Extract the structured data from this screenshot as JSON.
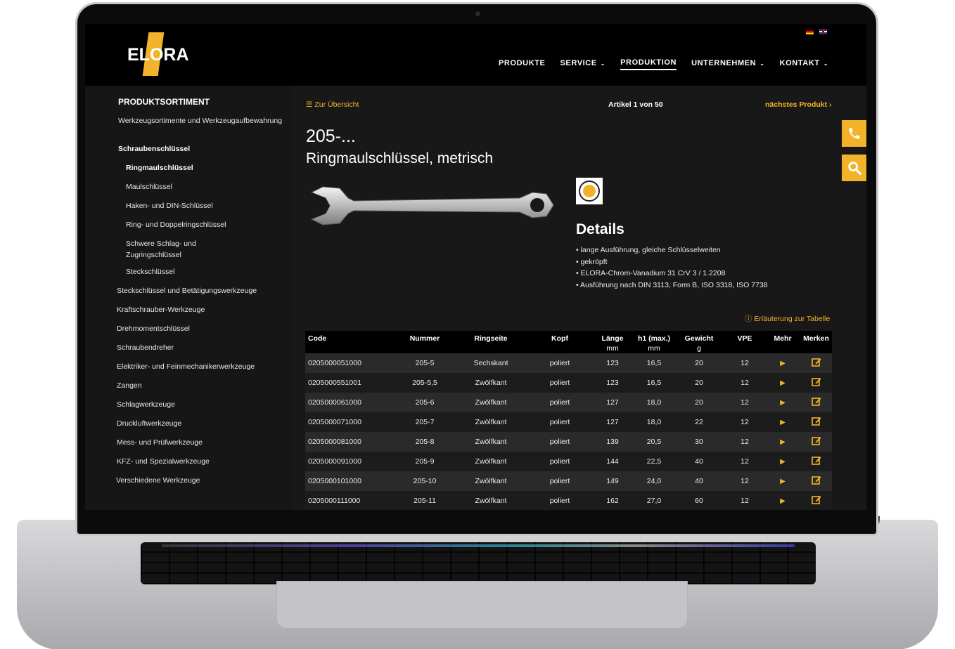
{
  "header": {
    "logo_text": "ELORA",
    "nav": [
      {
        "label": "PRODUKTE",
        "dropdown": false,
        "active": false
      },
      {
        "label": "SERVICE",
        "dropdown": true,
        "active": false
      },
      {
        "label": "PRODUKTION",
        "dropdown": false,
        "active": true
      },
      {
        "label": "UNTERNEHMEN",
        "dropdown": true,
        "active": false
      },
      {
        "label": "KONTAKT",
        "dropdown": true,
        "active": false
      }
    ],
    "flags": [
      "flag-de-icon",
      "flag-en-icon"
    ]
  },
  "sidebar": {
    "title": "PRODUKTSORTIMENT",
    "items": [
      {
        "label": "Werkzeugsortimente und Werkzeugaufbewahrung",
        "bold": false
      },
      {
        "label": "Schraubenschlüssel",
        "bold": true
      },
      {
        "label": "Ringmaulschlüssel",
        "bold": true
      },
      {
        "label": "Maulschlüssel",
        "bold": false
      },
      {
        "label": "Haken- und DIN-Schlüssel",
        "bold": false
      },
      {
        "label": "Ring- und Doppelringschlüssel",
        "bold": false
      },
      {
        "label": "Schwere Schlag- und Zugringschlüssel",
        "bold": false
      },
      {
        "label": "Steckschlüssel",
        "bold": false
      },
      {
        "label": "Steckschlüssel und Betätigungswerkzeuge",
        "bold": false
      },
      {
        "label": "Kraftschrauber-Werkzeuge",
        "bold": false
      },
      {
        "label": "Drehmomentschlüssel",
        "bold": false
      },
      {
        "label": "Schraubendreher",
        "bold": false
      },
      {
        "label": "Elektriker- und Feinmechanikerwerkzeuge",
        "bold": false
      },
      {
        "label": "Zangen",
        "bold": false
      },
      {
        "label": "Schlagwerkzeuge",
        "bold": false
      },
      {
        "label": "Druckluftwerkzeuge",
        "bold": false
      },
      {
        "label": "Mess- und Prüfwerkzeuge",
        "bold": false
      },
      {
        "label": "KFZ- und Spezialwerkzeuge",
        "bold": false
      },
      {
        "label": "Verschiedene Werkzeuge",
        "bold": false
      }
    ]
  },
  "main": {
    "back_label": "Zur Übersicht",
    "article_count": "Artikel 1 von 50",
    "next_label": "nächstes Produkt",
    "product_number": "205-...",
    "product_name": "Ringmaulschlüssel, metrisch",
    "details_title": "Details",
    "details": [
      "lange Ausführung, gleiche Schlüsselweiten",
      "gekröpft",
      "ELORA-Chrom-Vanadium 31 CrV 3 / 1.2208",
      "Ausführung nach DIN 3113, Form B, ISO 3318, ISO 7738"
    ],
    "badge_label": "PROFIL",
    "legend_label": "Erläuterung zur Tabelle"
  },
  "table": {
    "headers": [
      {
        "label": "Code",
        "unit": ""
      },
      {
        "label": "Nummer",
        "unit": ""
      },
      {
        "label": "Ringseite",
        "unit": ""
      },
      {
        "label": "Kopf",
        "unit": ""
      },
      {
        "label": "Länge",
        "unit": "mm"
      },
      {
        "label": "h1 (max.)",
        "unit": "mm"
      },
      {
        "label": "Gewicht",
        "unit": "g"
      },
      {
        "label": "VPE",
        "unit": ""
      },
      {
        "label": "Mehr",
        "unit": ""
      },
      {
        "label": "Merken",
        "unit": ""
      }
    ],
    "rows": [
      [
        "0205000051000",
        "205-5",
        "Sechskant",
        "poliert",
        "123",
        "16,5",
        "20",
        "12"
      ],
      [
        "0205000551001",
        "205-5,5",
        "Zwölfkant",
        "poliert",
        "123",
        "16,5",
        "20",
        "12"
      ],
      [
        "0205000061000",
        "205-6",
        "Zwölfkant",
        "poliert",
        "127",
        "18,0",
        "20",
        "12"
      ],
      [
        "0205000071000",
        "205-7",
        "Zwölfkant",
        "poliert",
        "127",
        "18,0",
        "22",
        "12"
      ],
      [
        "0205000081000",
        "205-8",
        "Zwölfkant",
        "poliert",
        "139",
        "20,5",
        "30",
        "12"
      ],
      [
        "0205000091000",
        "205-9",
        "Zwölfkant",
        "poliert",
        "144",
        "22,5",
        "40",
        "12"
      ],
      [
        "0205000101000",
        "205-10",
        "Zwölfkant",
        "poliert",
        "149",
        "24,0",
        "40",
        "12"
      ],
      [
        "0205000111000",
        "205-11",
        "Zwölfkant",
        "poliert",
        "162",
        "27,0",
        "60",
        "12"
      ]
    ]
  },
  "colors": {
    "accent": "#f2b32a",
    "background": "#181818",
    "header": "#000000"
  },
  "icons": {
    "phone": "phone-icon",
    "search": "search-icon",
    "menu": "menu-icon",
    "more": "play-arrow-icon",
    "bookmark": "edit-note-icon"
  }
}
